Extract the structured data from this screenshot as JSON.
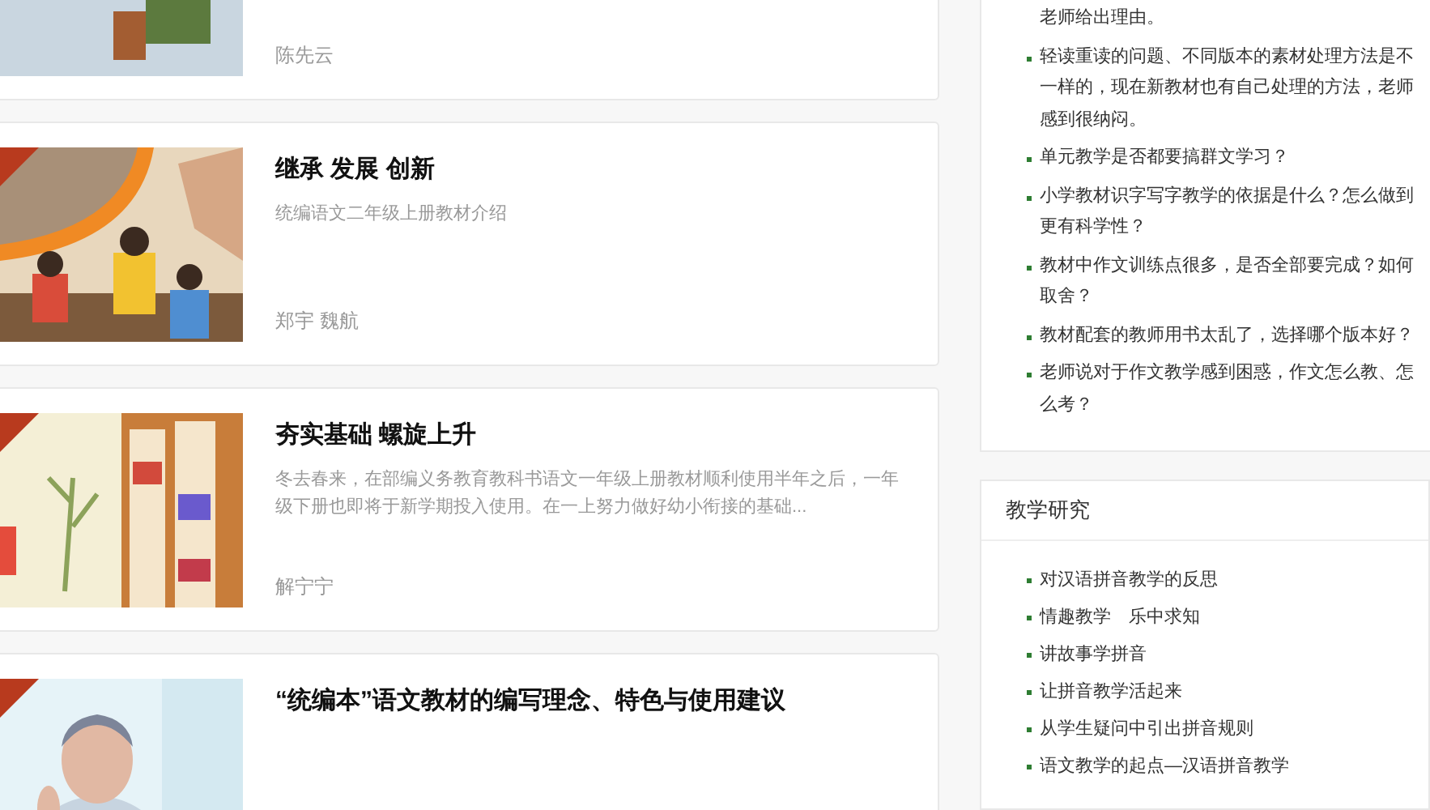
{
  "articles": [
    {
      "kind": "picture",
      "author": "陈先云"
    },
    {
      "kind": "picture",
      "ribbon": true,
      "title": "继承 发展 创新",
      "summary": "统编语文二年级上册教材介绍",
      "author": "郑宇 魏航"
    },
    {
      "kind": "picture",
      "ribbon": true,
      "title": "夯实基础 螺旋上升",
      "summary": "冬去春来，在部编义务教育教科书语文一年级上册教材顺利使用半年之后，一年级下册也即将于新学期投入使用。在一上努力做好幼小衔接的基础...",
      "author": "解宁宁"
    },
    {
      "kind": "picture",
      "ribbon": true,
      "title": "“统编本”语文教材的编写理念、特色与使用建议"
    }
  ],
  "questions": {
    "items": [
      {
        "text": "老师给出理由。",
        "bullet": false
      },
      {
        "text": "轻读重读的问题、不同版本的素材处理方法是不一样的，现在新教材也有自己处理的方法，老师感到很纳闷。",
        "bullet": true
      },
      {
        "text": "单元教学是否都要搞群文学习？",
        "bullet": true
      },
      {
        "text": "小学教材识字写字教学的依据是什么？怎么做到更有科学性？",
        "bullet": true
      },
      {
        "text": "教材中作文训练点很多，是否全部要完成？如何取舍？",
        "bullet": true
      },
      {
        "text": "教材配套的教师用书太乱了，选择哪个版本好？",
        "bullet": true
      },
      {
        "text": "老师说对于作文教学感到困惑，作文怎么教、怎么考？",
        "bullet": true
      }
    ]
  },
  "research": {
    "title": "教学研究",
    "items": [
      "对汉语拼音教学的反思",
      "情趣教学　乐中求知",
      "讲故事学拼音",
      "让拼音教学活起来",
      "从学生疑问中引出拼音规则",
      "语文教学的起点—汉语拼音教学"
    ]
  }
}
